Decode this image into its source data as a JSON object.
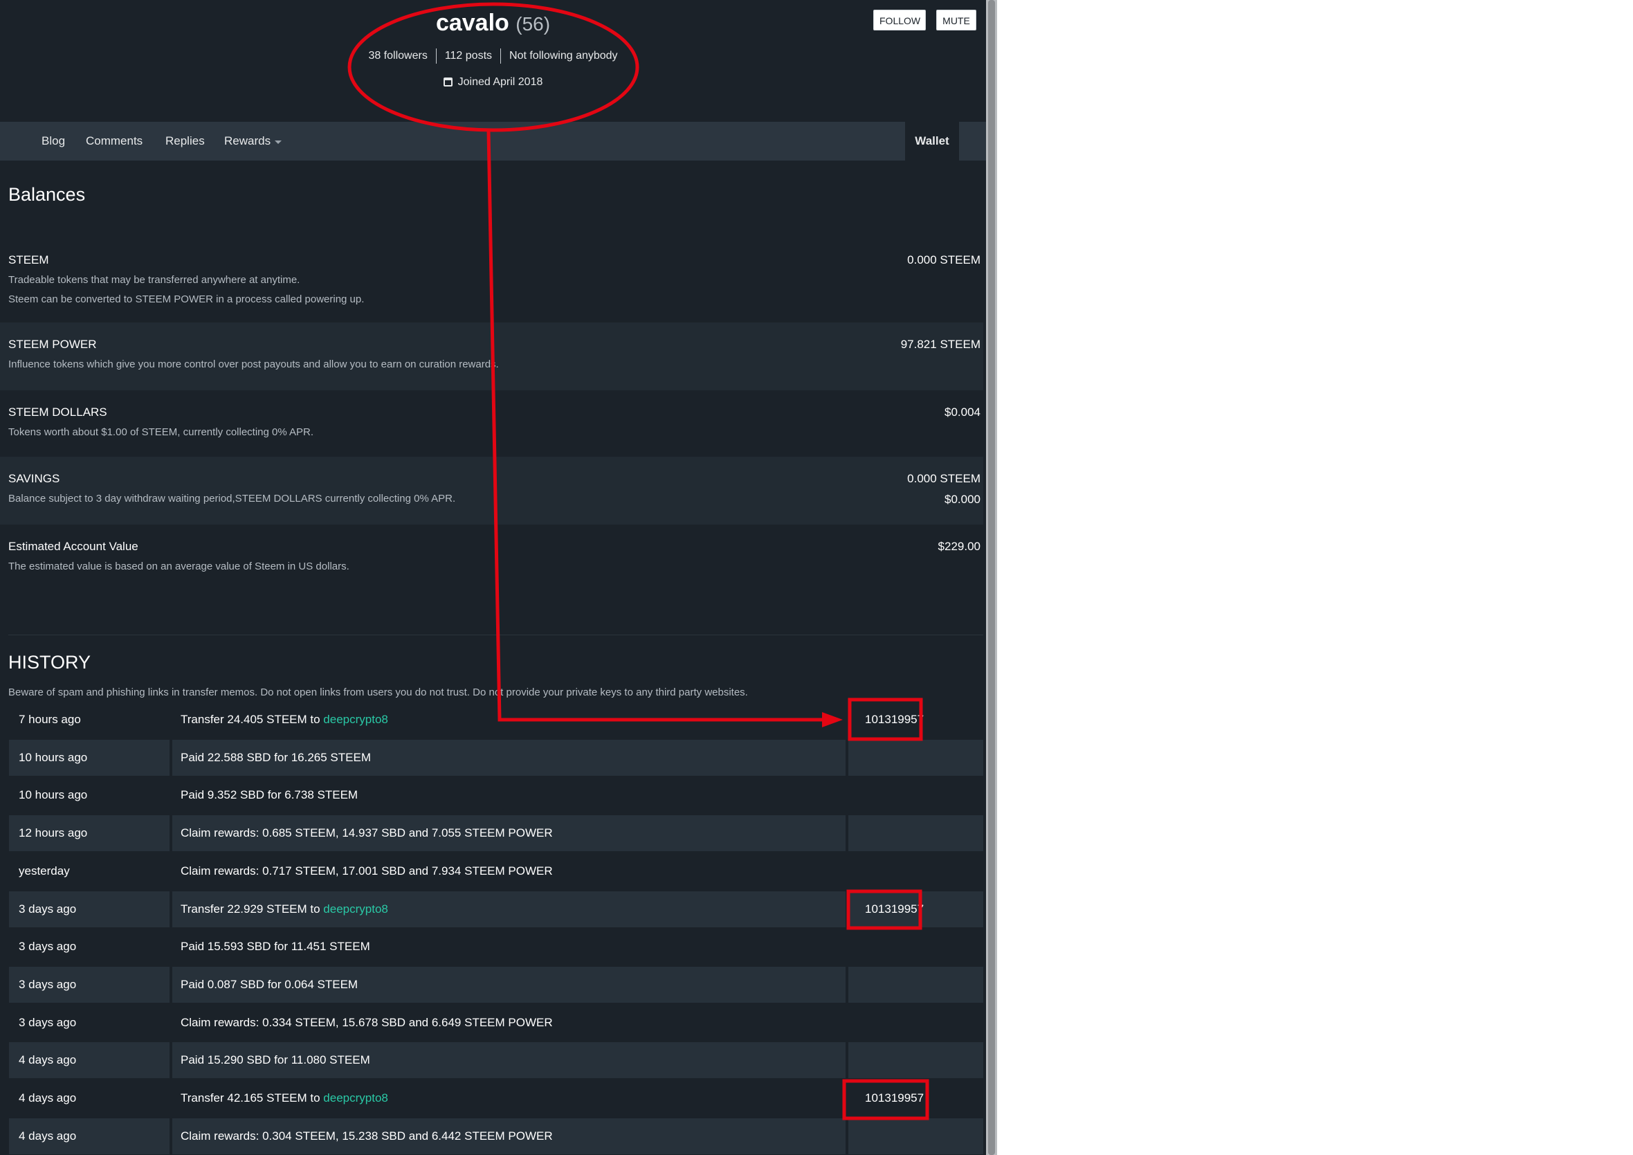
{
  "profile": {
    "username": "cavalo",
    "reputation": "(56)",
    "followers": "38 followers",
    "posts": "112 posts",
    "following": "Not following anybody",
    "joined": "Joined April 2018",
    "follow_label": "FOLLOW",
    "mute_label": "MUTE"
  },
  "tabs": {
    "blog": "Blog",
    "comments": "Comments",
    "replies": "Replies",
    "rewards": "Rewards",
    "wallet": "Wallet"
  },
  "balances": {
    "title": "Balances",
    "steem": {
      "title": "STEEM",
      "desc1": "Tradeable tokens that may be transferred anywhere at anytime.",
      "desc2": "Steem can be converted to STEEM POWER in a process called powering up.",
      "value": "0.000 STEEM"
    },
    "steem_power": {
      "title": "STEEM POWER",
      "desc": "Influence tokens which give you more control over post payouts and allow you to earn on curation rewards.",
      "value": "97.821 STEEM"
    },
    "steem_dollars": {
      "title": "STEEM DOLLARS",
      "desc": "Tokens worth about $1.00 of STEEM, currently collecting 0% APR.",
      "value": "$0.004"
    },
    "savings": {
      "title": "SAVINGS",
      "desc": "Balance subject to 3 day withdraw waiting period,STEEM DOLLARS currently collecting 0% APR.",
      "value1": "0.000 STEEM",
      "value2": "$0.000"
    },
    "estimated": {
      "title": "Estimated Account Value",
      "desc": "The estimated value is based on an average value of Steem in US dollars.",
      "value": "$229.00"
    }
  },
  "history": {
    "title": "HISTORY",
    "warning": "Beware of spam and phishing links in transfer memos. Do not open links from users you do not trust. Do not provide your private keys to any third party websites.",
    "rows": [
      {
        "time": "7 hours ago",
        "desc": "Transfer 24.405 STEEM to ",
        "link": "deepcrypto8",
        "memo": "101319957"
      },
      {
        "time": "10 hours ago",
        "desc": "Paid 22.588 SBD for 16.265 STEEM",
        "link": "",
        "memo": ""
      },
      {
        "time": "10 hours ago",
        "desc": "Paid 9.352 SBD for 6.738 STEEM",
        "link": "",
        "memo": ""
      },
      {
        "time": "12 hours ago",
        "desc": "Claim rewards: 0.685 STEEM, 14.937 SBD and 7.055 STEEM POWER",
        "link": "",
        "memo": ""
      },
      {
        "time": "yesterday",
        "desc": "Claim rewards: 0.717 STEEM, 17.001 SBD and 7.934 STEEM POWER",
        "link": "",
        "memo": ""
      },
      {
        "time": "3 days ago",
        "desc": "Transfer 22.929 STEEM to ",
        "link": "deepcrypto8",
        "memo": "101319957"
      },
      {
        "time": "3 days ago",
        "desc": "Paid 15.593 SBD for 11.451 STEEM",
        "link": "",
        "memo": ""
      },
      {
        "time": "3 days ago",
        "desc": "Paid 0.087 SBD for 0.064 STEEM",
        "link": "",
        "memo": ""
      },
      {
        "time": "3 days ago",
        "desc": "Claim rewards: 0.334 STEEM, 15.678 SBD and 6.649 STEEM POWER",
        "link": "",
        "memo": ""
      },
      {
        "time": "4 days ago",
        "desc": "Paid 15.290 SBD for 11.080 STEEM",
        "link": "",
        "memo": ""
      },
      {
        "time": "4 days ago",
        "desc": "Transfer 42.165 STEEM to ",
        "link": "deepcrypto8",
        "memo": "101319957"
      },
      {
        "time": "4 days ago",
        "desc": "Claim rewards: 0.304 STEEM, 15.238 SBD and 6.442 STEEM POWER",
        "link": "",
        "memo": ""
      }
    ]
  },
  "colors": {
    "background": "#1b2229",
    "tab_bar": "#2c3640",
    "link": "#2ac9a6",
    "annotation": "#e30613"
  }
}
